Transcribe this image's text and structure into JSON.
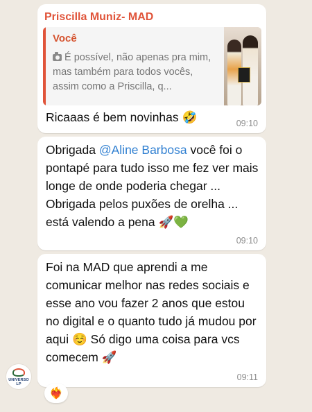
{
  "messages": [
    {
      "sender": "Priscilla Muniz- MAD",
      "quote": {
        "author": "Você",
        "icon": "camera-icon",
        "text": "É possível, não apenas pra mim, mas também para todos vocês, assim como a Priscilla, q..."
      },
      "text": "Ricaaas é bem novinhas 🤣",
      "time": "09:10"
    },
    {
      "text_before": "Obrigada ",
      "mention": "@Aline Barbosa",
      "text_after": "  você foi o pontapé para tudo isso me fez ver mais longe de onde poderia chegar ... Obrigada pelos puxões de orelha ... está valendo a pena 🚀💚",
      "time": "09:10"
    },
    {
      "text": "Foi na MAD que aprendi a me comunicar melhor nas redes sociais e esse ano vou fazer 2 anos que estou no digital e o quanto tudo já mudou por aqui ☺️ Só digo uma coisa para vcs comecem 🚀",
      "time": "09:11"
    }
  ],
  "avatar": {
    "brand": "UNIVERSO LP"
  },
  "reaction": {
    "emoji": "❤️‍🔥"
  },
  "colors": {
    "sender": "#e0543a",
    "mention": "#2f7fd1",
    "background": "#efeae2"
  }
}
